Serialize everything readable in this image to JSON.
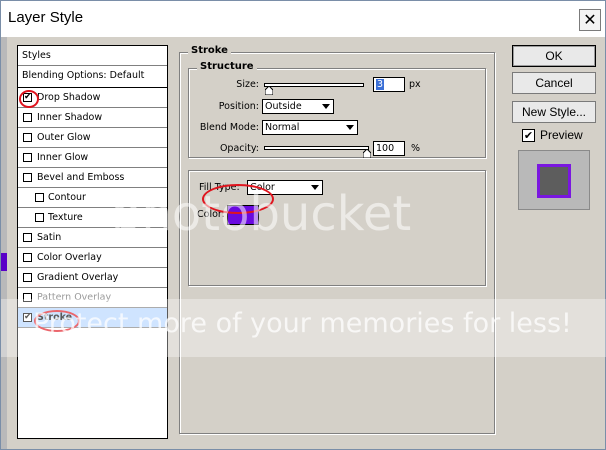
{
  "window": {
    "title": "Layer Style",
    "close_glyph": "✕"
  },
  "styles_panel": {
    "header": "Styles",
    "items": [
      {
        "label": "Blending Options: Default",
        "checkbox": false,
        "checked": false
      },
      {
        "label": "Drop Shadow",
        "checkbox": true,
        "checked": true
      },
      {
        "label": "Inner Shadow",
        "checkbox": true,
        "checked": false
      },
      {
        "label": "Outer Glow",
        "checkbox": true,
        "checked": false
      },
      {
        "label": "Inner Glow",
        "checkbox": true,
        "checked": false
      },
      {
        "label": "Bevel and Emboss",
        "checkbox": true,
        "checked": false
      },
      {
        "label": "Contour",
        "checkbox": true,
        "checked": false,
        "indent": true
      },
      {
        "label": "Texture",
        "checkbox": true,
        "checked": false,
        "indent": true
      },
      {
        "label": "Satin",
        "checkbox": true,
        "checked": false
      },
      {
        "label": "Color Overlay",
        "checkbox": true,
        "checked": false
      },
      {
        "label": "Gradient Overlay",
        "checkbox": true,
        "checked": false
      },
      {
        "label": "Pattern Overlay",
        "checkbox": true,
        "checked": false,
        "disabled": true
      },
      {
        "label": "Stroke",
        "checkbox": true,
        "checked": true,
        "selected": true
      }
    ],
    "check_glyph": "✔"
  },
  "stroke": {
    "group_title": "Stroke",
    "structure_title": "Structure",
    "size_label": "Size:",
    "size_value": "3",
    "size_unit": "px",
    "position_label": "Position:",
    "position_value": "Outside",
    "blend_label": "Blend Mode:",
    "blend_value": "Normal",
    "opacity_label": "Opacity:",
    "opacity_value": "100",
    "opacity_unit": "%",
    "fill_type_label": "Fill Type:",
    "fill_type_value": "Color",
    "color_label": "Color:",
    "stroke_color": "#7a16e0"
  },
  "buttons": {
    "ok": "OK",
    "cancel": "Cancel",
    "new_style": "New Style...",
    "preview_label": "Preview",
    "preview_checked": true
  },
  "watermark": {
    "line1": "photobucket",
    "line2": "Protect more of your memories for less!"
  }
}
